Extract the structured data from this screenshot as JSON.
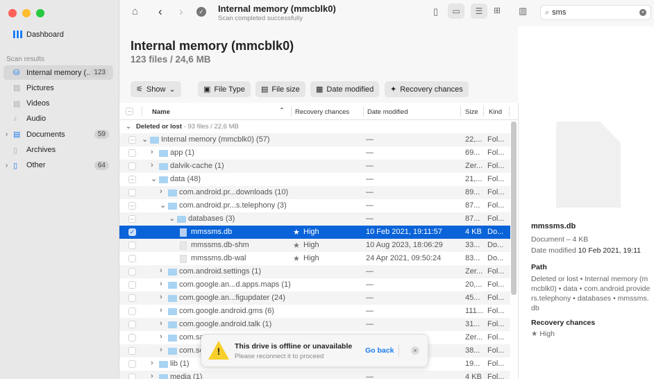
{
  "window": {
    "title": "Internal memory (mmcblk0)",
    "subtitle": "Scan completed successfully",
    "traffic_colors": [
      "#fe5f57",
      "#febc2e",
      "#28c840"
    ]
  },
  "search": {
    "value": "sms"
  },
  "sidebar": {
    "dashboard": "Dashboard",
    "section": "Scan results",
    "items": [
      {
        "label": "Internal memory (...",
        "badge": "123",
        "icon": "drive-icon",
        "active": true
      },
      {
        "label": "Pictures",
        "badge": "",
        "icon": "picture-icon"
      },
      {
        "label": "Videos",
        "badge": "",
        "icon": "video-icon"
      },
      {
        "label": "Audio",
        "badge": "",
        "icon": "music-icon"
      },
      {
        "label": "Documents",
        "badge": "59",
        "icon": "document-icon",
        "expandable": true
      },
      {
        "label": "Archives",
        "badge": "",
        "icon": "archive-icon"
      },
      {
        "label": "Other",
        "badge": "64",
        "icon": "other-icon",
        "expandable": true
      }
    ]
  },
  "header": {
    "title": "Internal memory (mmcblk0)",
    "summary": "123 files / 24,6 MB"
  },
  "filters": {
    "show": "Show",
    "file_type": "File Type",
    "file_size": "File size",
    "date_modified": "Date modified",
    "recovery": "Recovery chances"
  },
  "table": {
    "columns": {
      "name": "Name",
      "recovery": "Recovery chances",
      "date": "Date modified",
      "size": "Size",
      "kind": "Kind"
    },
    "group": {
      "label": "Deleted or lost",
      "detail": " - 93 files / 22,6 MB"
    },
    "rows": [
      {
        "level": 0,
        "exp": "open",
        "type": "folder",
        "cb": "dash",
        "name": "Internal memory (mmcblk0) (57)",
        "rec": "",
        "date": "—",
        "size": "22,...",
        "kind": "Fol..."
      },
      {
        "level": 1,
        "exp": "closed",
        "type": "folder",
        "cb": "empty",
        "name": "app (1)",
        "rec": "",
        "date": "—",
        "size": "69...",
        "kind": "Fol..."
      },
      {
        "level": 1,
        "exp": "closed",
        "type": "folder",
        "cb": "empty",
        "name": "dalvik-cache (1)",
        "rec": "",
        "date": "—",
        "size": "Zer...",
        "kind": "Fol..."
      },
      {
        "level": 1,
        "exp": "open",
        "type": "folder",
        "cb": "dash",
        "name": "data (48)",
        "rec": "",
        "date": "—",
        "size": "21,...",
        "kind": "Fol..."
      },
      {
        "level": 2,
        "exp": "closed",
        "type": "folder",
        "cb": "empty",
        "name": "com.android.pr...downloads (10)",
        "rec": "",
        "date": "—",
        "size": "89...",
        "kind": "Fol..."
      },
      {
        "level": 2,
        "exp": "open",
        "type": "folder",
        "cb": "dash",
        "name": "com.android.pr...s.telephony (3)",
        "rec": "",
        "date": "—",
        "size": "87...",
        "kind": "Fol..."
      },
      {
        "level": 3,
        "exp": "open",
        "type": "folder",
        "cb": "dash",
        "name": "databases (3)",
        "rec": "",
        "date": "—",
        "size": "87...",
        "kind": "Fol..."
      },
      {
        "level": 4,
        "exp": "",
        "type": "file",
        "cb": "checked",
        "name": "mmssms.db",
        "rec": "High",
        "date": "10 Feb 2021, 19:11:57",
        "size": "4 KB",
        "kind": "Do...",
        "selected": true
      },
      {
        "level": 4,
        "exp": "",
        "type": "file",
        "cb": "empty",
        "name": "mmssms.db-shm",
        "rec": "High",
        "date": "10 Aug 2023, 18:06:29",
        "size": "33...",
        "kind": "Do..."
      },
      {
        "level": 4,
        "exp": "",
        "type": "file",
        "cb": "empty",
        "name": "mmssms.db-wal",
        "rec": "High",
        "date": "24 Apr 2021, 09:50:24",
        "size": "83...",
        "kind": "Do..."
      },
      {
        "level": 2,
        "exp": "closed",
        "type": "folder",
        "cb": "empty",
        "name": "com.android.settings (1)",
        "rec": "",
        "date": "—",
        "size": "Zer...",
        "kind": "Fol..."
      },
      {
        "level": 2,
        "exp": "closed",
        "type": "folder",
        "cb": "empty",
        "name": "com.google.an...d.apps.maps (1)",
        "rec": "",
        "date": "—",
        "size": "20,...",
        "kind": "Fol..."
      },
      {
        "level": 2,
        "exp": "closed",
        "type": "folder",
        "cb": "empty",
        "name": "com.google.an...figupdater (24)",
        "rec": "",
        "date": "—",
        "size": "45...",
        "kind": "Fol..."
      },
      {
        "level": 2,
        "exp": "closed",
        "type": "folder",
        "cb": "empty",
        "name": "com.google.android.gms (6)",
        "rec": "",
        "date": "—",
        "size": "111...",
        "kind": "Fol..."
      },
      {
        "level": 2,
        "exp": "closed",
        "type": "folder",
        "cb": "empty",
        "name": "com.google.android.talk (1)",
        "rec": "",
        "date": "—",
        "size": "31...",
        "kind": "Fol..."
      },
      {
        "level": 2,
        "exp": "closed",
        "type": "folder",
        "cb": "empty",
        "name": "com.sa",
        "rec": "",
        "date": "",
        "size": "Zer...",
        "kind": "Fol..."
      },
      {
        "level": 2,
        "exp": "closed",
        "type": "folder",
        "cb": "empty",
        "name": "com.se",
        "rec": "",
        "date": "",
        "size": "38...",
        "kind": "Fol..."
      },
      {
        "level": 1,
        "exp": "closed",
        "type": "folder",
        "cb": "empty",
        "name": "lib (1)",
        "rec": "",
        "date": "",
        "size": "19...",
        "kind": "Fol..."
      },
      {
        "level": 1,
        "exp": "closed",
        "type": "folder",
        "cb": "empty",
        "name": "media (1)",
        "rec": "",
        "date": "—",
        "size": "4 KB",
        "kind": "Fol..."
      }
    ]
  },
  "details": {
    "name": "mmssms.db",
    "meta": "Document – 4 KB",
    "date_label": "Date modified",
    "date": "10 Feb 2021, 19:11",
    "path_label": "Path",
    "path": "Deleted or lost • Internal memory (mmcblk0) • data • com.android.providers.telephony • databases • mmssms.db",
    "recovery_label": "Recovery chances",
    "recovery": "High"
  },
  "toast": {
    "title": "This drive is offline or unavailable",
    "message": "Please reconnect it to proceed",
    "action": "Go back"
  },
  "colors": {
    "accent": "#0a63d8",
    "warning": "#f7cf2b"
  }
}
